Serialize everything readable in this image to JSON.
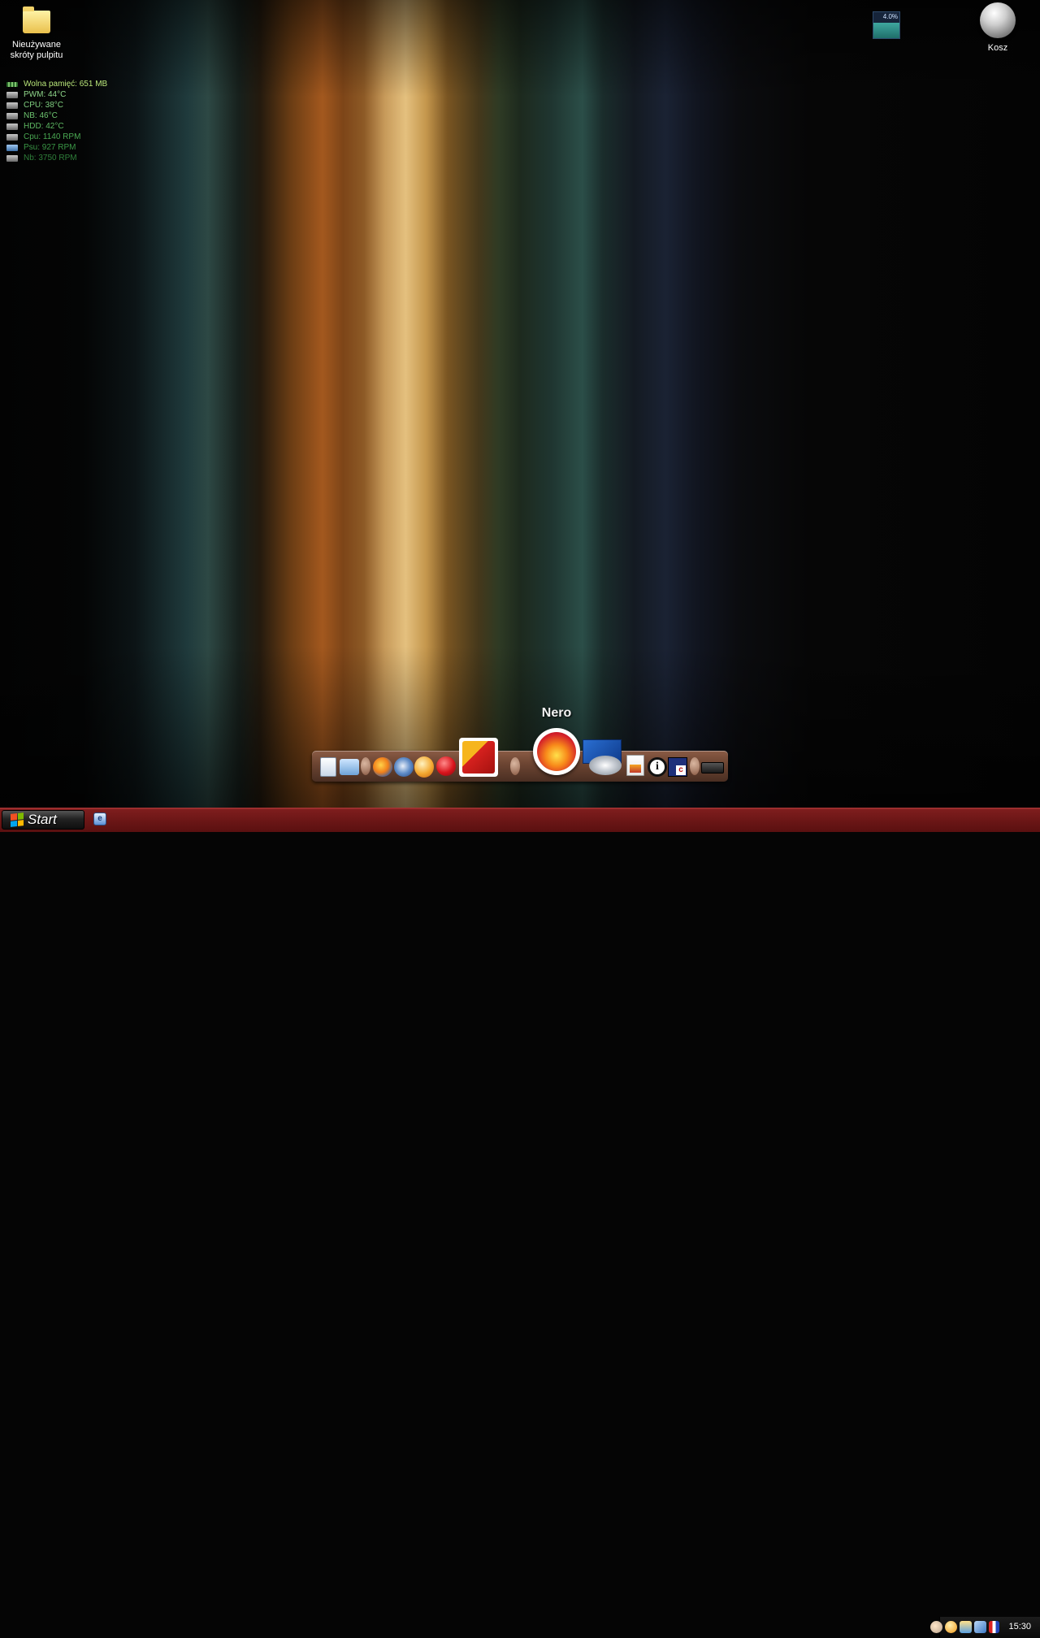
{
  "desktop": {
    "icons": [
      {
        "name": "folder-icon",
        "label_line1": "Nieużywane",
        "label_line2": "skróty pulpitu"
      },
      {
        "name": "recycle-bin-icon",
        "label": "Kosz"
      }
    ],
    "cpu_meter": {
      "label": "4.0%",
      "level": 0.6
    }
  },
  "sensors": [
    {
      "icon": "memory-icon",
      "text": "Wolna pamięć: 651 MB",
      "color": "#b9e67a"
    },
    {
      "icon": "fan-icon",
      "text": "PWM: 44°C",
      "color": "#8fd68a"
    },
    {
      "icon": "cpu-icon",
      "text": "CPU: 38°C",
      "color": "#7fcf7f"
    },
    {
      "icon": "chip-icon",
      "text": "NB: 46°C",
      "color": "#6dc46f"
    },
    {
      "icon": "disk-icon",
      "text": "HDD: 42°C",
      "color": "#5db862"
    },
    {
      "icon": "fan-icon",
      "text": "Cpu: 1140 RPM",
      "color": "#4aa852"
    },
    {
      "icon": "psu-icon",
      "text": "Psu: 927 RPM",
      "color": "#3a9645"
    },
    {
      "icon": "chip-icon",
      "text": "Nb: 3750 RPM",
      "color": "#2f7f3a"
    }
  ],
  "dock": {
    "tooltip": "Nero",
    "items": [
      {
        "name": "notepad-icon"
      },
      {
        "name": "folder-open-icon"
      },
      {
        "name": "firefox-icon"
      },
      {
        "name": "thunderbird-icon"
      },
      {
        "name": "opera-icon"
      },
      {
        "name": "capsule-icon"
      },
      {
        "name": "app-3-icon"
      },
      {
        "name": "nero-icon"
      },
      {
        "name": "windows-cd-icon"
      },
      {
        "name": "document-icon"
      },
      {
        "name": "info-icon"
      },
      {
        "name": "c-icon"
      },
      {
        "name": "keyboard-icon"
      }
    ]
  },
  "taskbar": {
    "start_label": "Start",
    "clock": "15:30",
    "tray_icons": [
      "tray-flash-icon",
      "tray-orange-icon",
      "tray-messenger-icon",
      "tray-network-icon",
      "tray-app-icon"
    ]
  },
  "colors": {
    "taskbar": "#6b1616",
    "dock": "#6e4633"
  }
}
